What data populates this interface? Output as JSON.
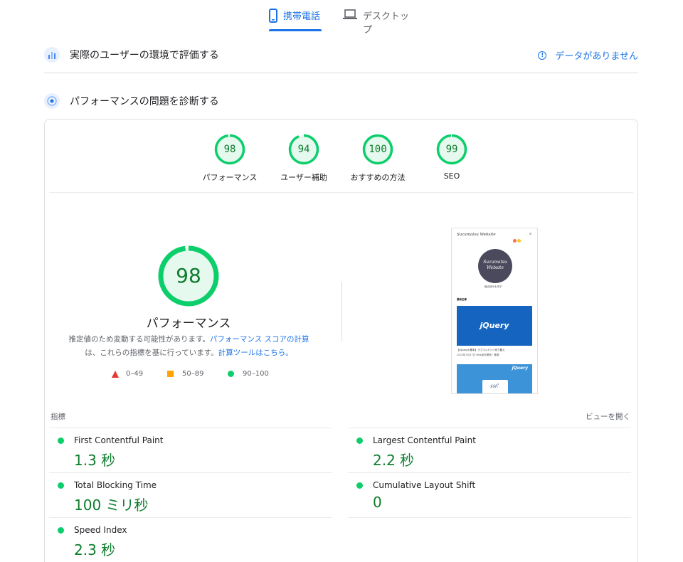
{
  "tabs": [
    {
      "label": "携帯電話",
      "active": true
    },
    {
      "label": "デスクトップ",
      "active": false
    }
  ],
  "real_world": {
    "title": "実際のユーザーの環境で評価する",
    "no_data": "データがありません"
  },
  "diagnose": {
    "title": "パフォーマンスの問題を診断する"
  },
  "categories": [
    {
      "score": "98",
      "value": 98,
      "label": "パフォーマンス"
    },
    {
      "score": "94",
      "value": 94,
      "label": "ユーザー補助"
    },
    {
      "score": "100",
      "value": 100,
      "label": "おすすめの方法"
    },
    {
      "score": "99",
      "value": 99,
      "label": "SEO"
    }
  ],
  "main_score": {
    "score": "98",
    "value": 98,
    "label": "パフォーマンス",
    "desc_1": "推定値のため変動する可能性があります。",
    "desc_link_1": "パフォーマンス スコアの計算",
    "desc_2": "は、これらの指標を基に行っています。",
    "desc_link_2": "計算ツールはこちら。"
  },
  "legend": {
    "poor": "0–49",
    "average": "50–89",
    "good": "90–100"
  },
  "screenshot": {
    "brand": "Suzumatsu Website",
    "logo_text": "Suzumatsu Website",
    "tagline": "最近読みを用す",
    "recent": "最新記事",
    "card_logo": "jQuery",
    "post_title": "【jQueryの基本】ラブコンテンツ切り替え",
    "post_meta": "2022年7月27日  Web制作関係・基礎",
    "card2_logo": "jQuery",
    "sign": "ﾒﾒﾊﾟ"
  },
  "metrics": {
    "heading": "指標",
    "expand": "ビューを開く",
    "items": [
      {
        "name": "First Contentful Paint",
        "value": "1.3 秒"
      },
      {
        "name": "Largest Contentful Paint",
        "value": "2.2 秒"
      },
      {
        "name": "Total Blocking Time",
        "value": "100 ミリ秒"
      },
      {
        "name": "Cumulative Layout Shift",
        "value": "0"
      },
      {
        "name": "Speed Index",
        "value": "2.3 秒"
      }
    ]
  },
  "colors": {
    "accent": "#1a73e8",
    "good": "#0cce6b",
    "good_text": "#0c7d2d",
    "good_fill": "#e6f9ee",
    "average": "#ffa400",
    "poor": "#e53935"
  }
}
